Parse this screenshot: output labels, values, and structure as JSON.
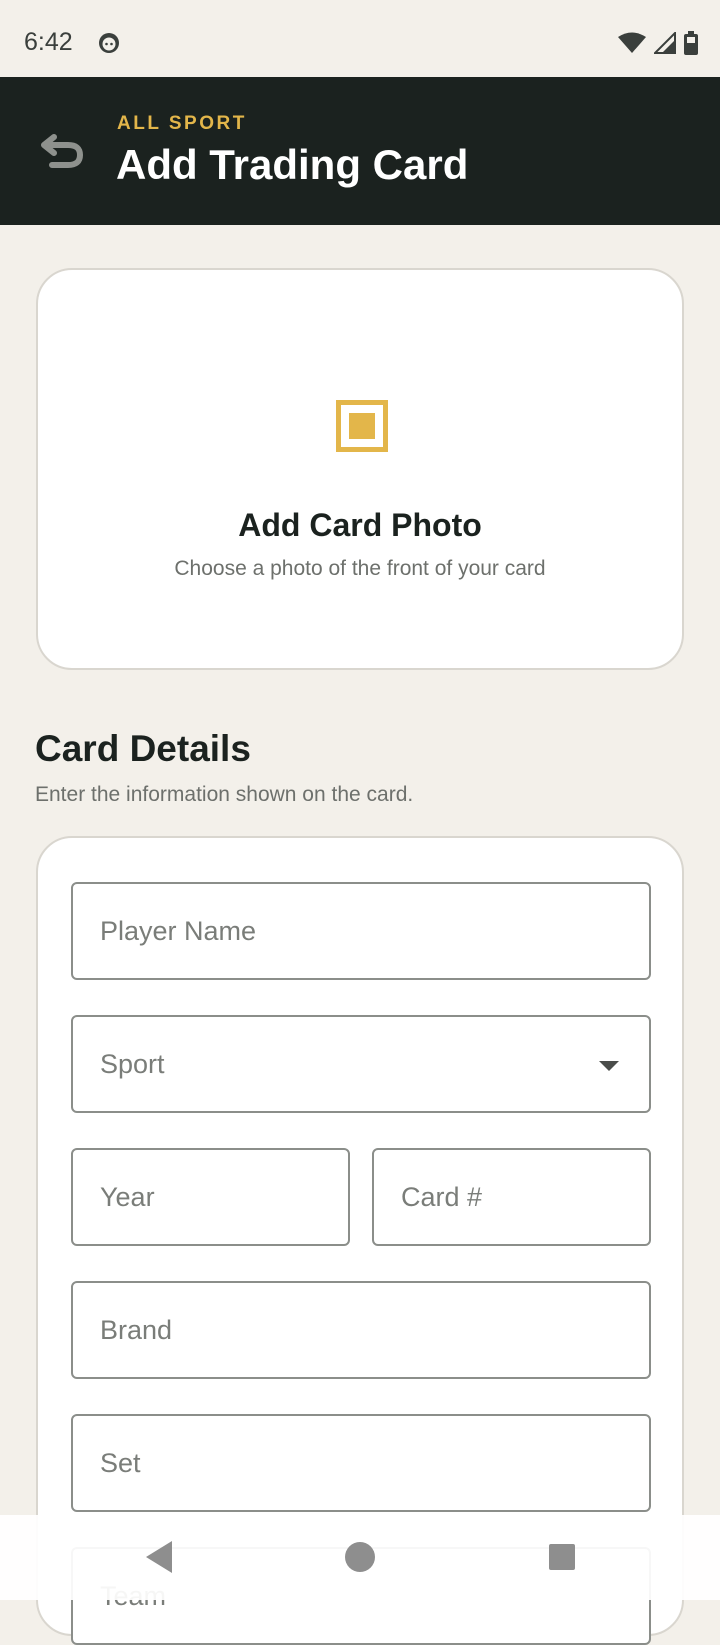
{
  "status_bar": {
    "time": "6:42"
  },
  "app_bar": {
    "eyebrow": "ALL SPORT",
    "title": "Add Trading Card"
  },
  "photo_card": {
    "title": "Add Card Photo",
    "subtitle": "Choose a photo of the front of your card"
  },
  "details": {
    "title": "Card Details",
    "subtitle": "Enter the information shown on the card."
  },
  "form": {
    "player_name": "Player Name",
    "sport": "Sport",
    "year": "Year",
    "card_number": "Card #",
    "brand": "Brand",
    "set": "Set",
    "team": "Team"
  },
  "colors": {
    "accent": "#e3b64a",
    "app_bar": "#1b221f",
    "background": "#f3f0ea"
  },
  "icons": [
    "face-icon",
    "wifi-icon",
    "signal-icon",
    "battery-icon",
    "back-arrow-icon",
    "photo-placeholder-icon",
    "chevron-down-icon",
    "nav-back-icon",
    "nav-home-icon",
    "nav-recents-icon"
  ]
}
